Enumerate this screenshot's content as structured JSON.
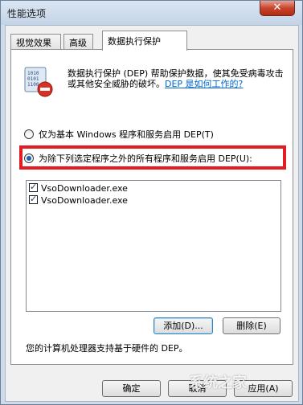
{
  "window": {
    "title": "性能选项",
    "close_label": "✕"
  },
  "tabs": [
    {
      "label": "视觉效果"
    },
    {
      "label": "高级"
    },
    {
      "label": "数据执行保护"
    }
  ],
  "dep": {
    "description": "数据执行保护 (DEP) 帮助保护数据，使其免受病毒攻击或其他安全威胁的破坏。",
    "help_link": "DEP 是如何工作的?",
    "option_essential": "仅为基本 Windows 程序和服务启用 DEP(T)",
    "option_all_except": "为除下列选定程序之外的所有程序和服务启用 DEP(U):",
    "selected_option": "option_all_except"
  },
  "exceptions": [
    {
      "name": "VsoDownloader.exe",
      "checked": true
    },
    {
      "name": "VsoDownloader.exe",
      "checked": true
    }
  ],
  "buttons": {
    "add": "添加(D)...",
    "remove": "删除(E)",
    "ok": "确定",
    "cancel": "取消",
    "apply": "应用(A)"
  },
  "status": "您的计算机处理器支持基于硬件的 DEP。",
  "watermark": "系统之家",
  "colors": {
    "highlight_border": "#e31b23",
    "link": "#0066cc"
  }
}
